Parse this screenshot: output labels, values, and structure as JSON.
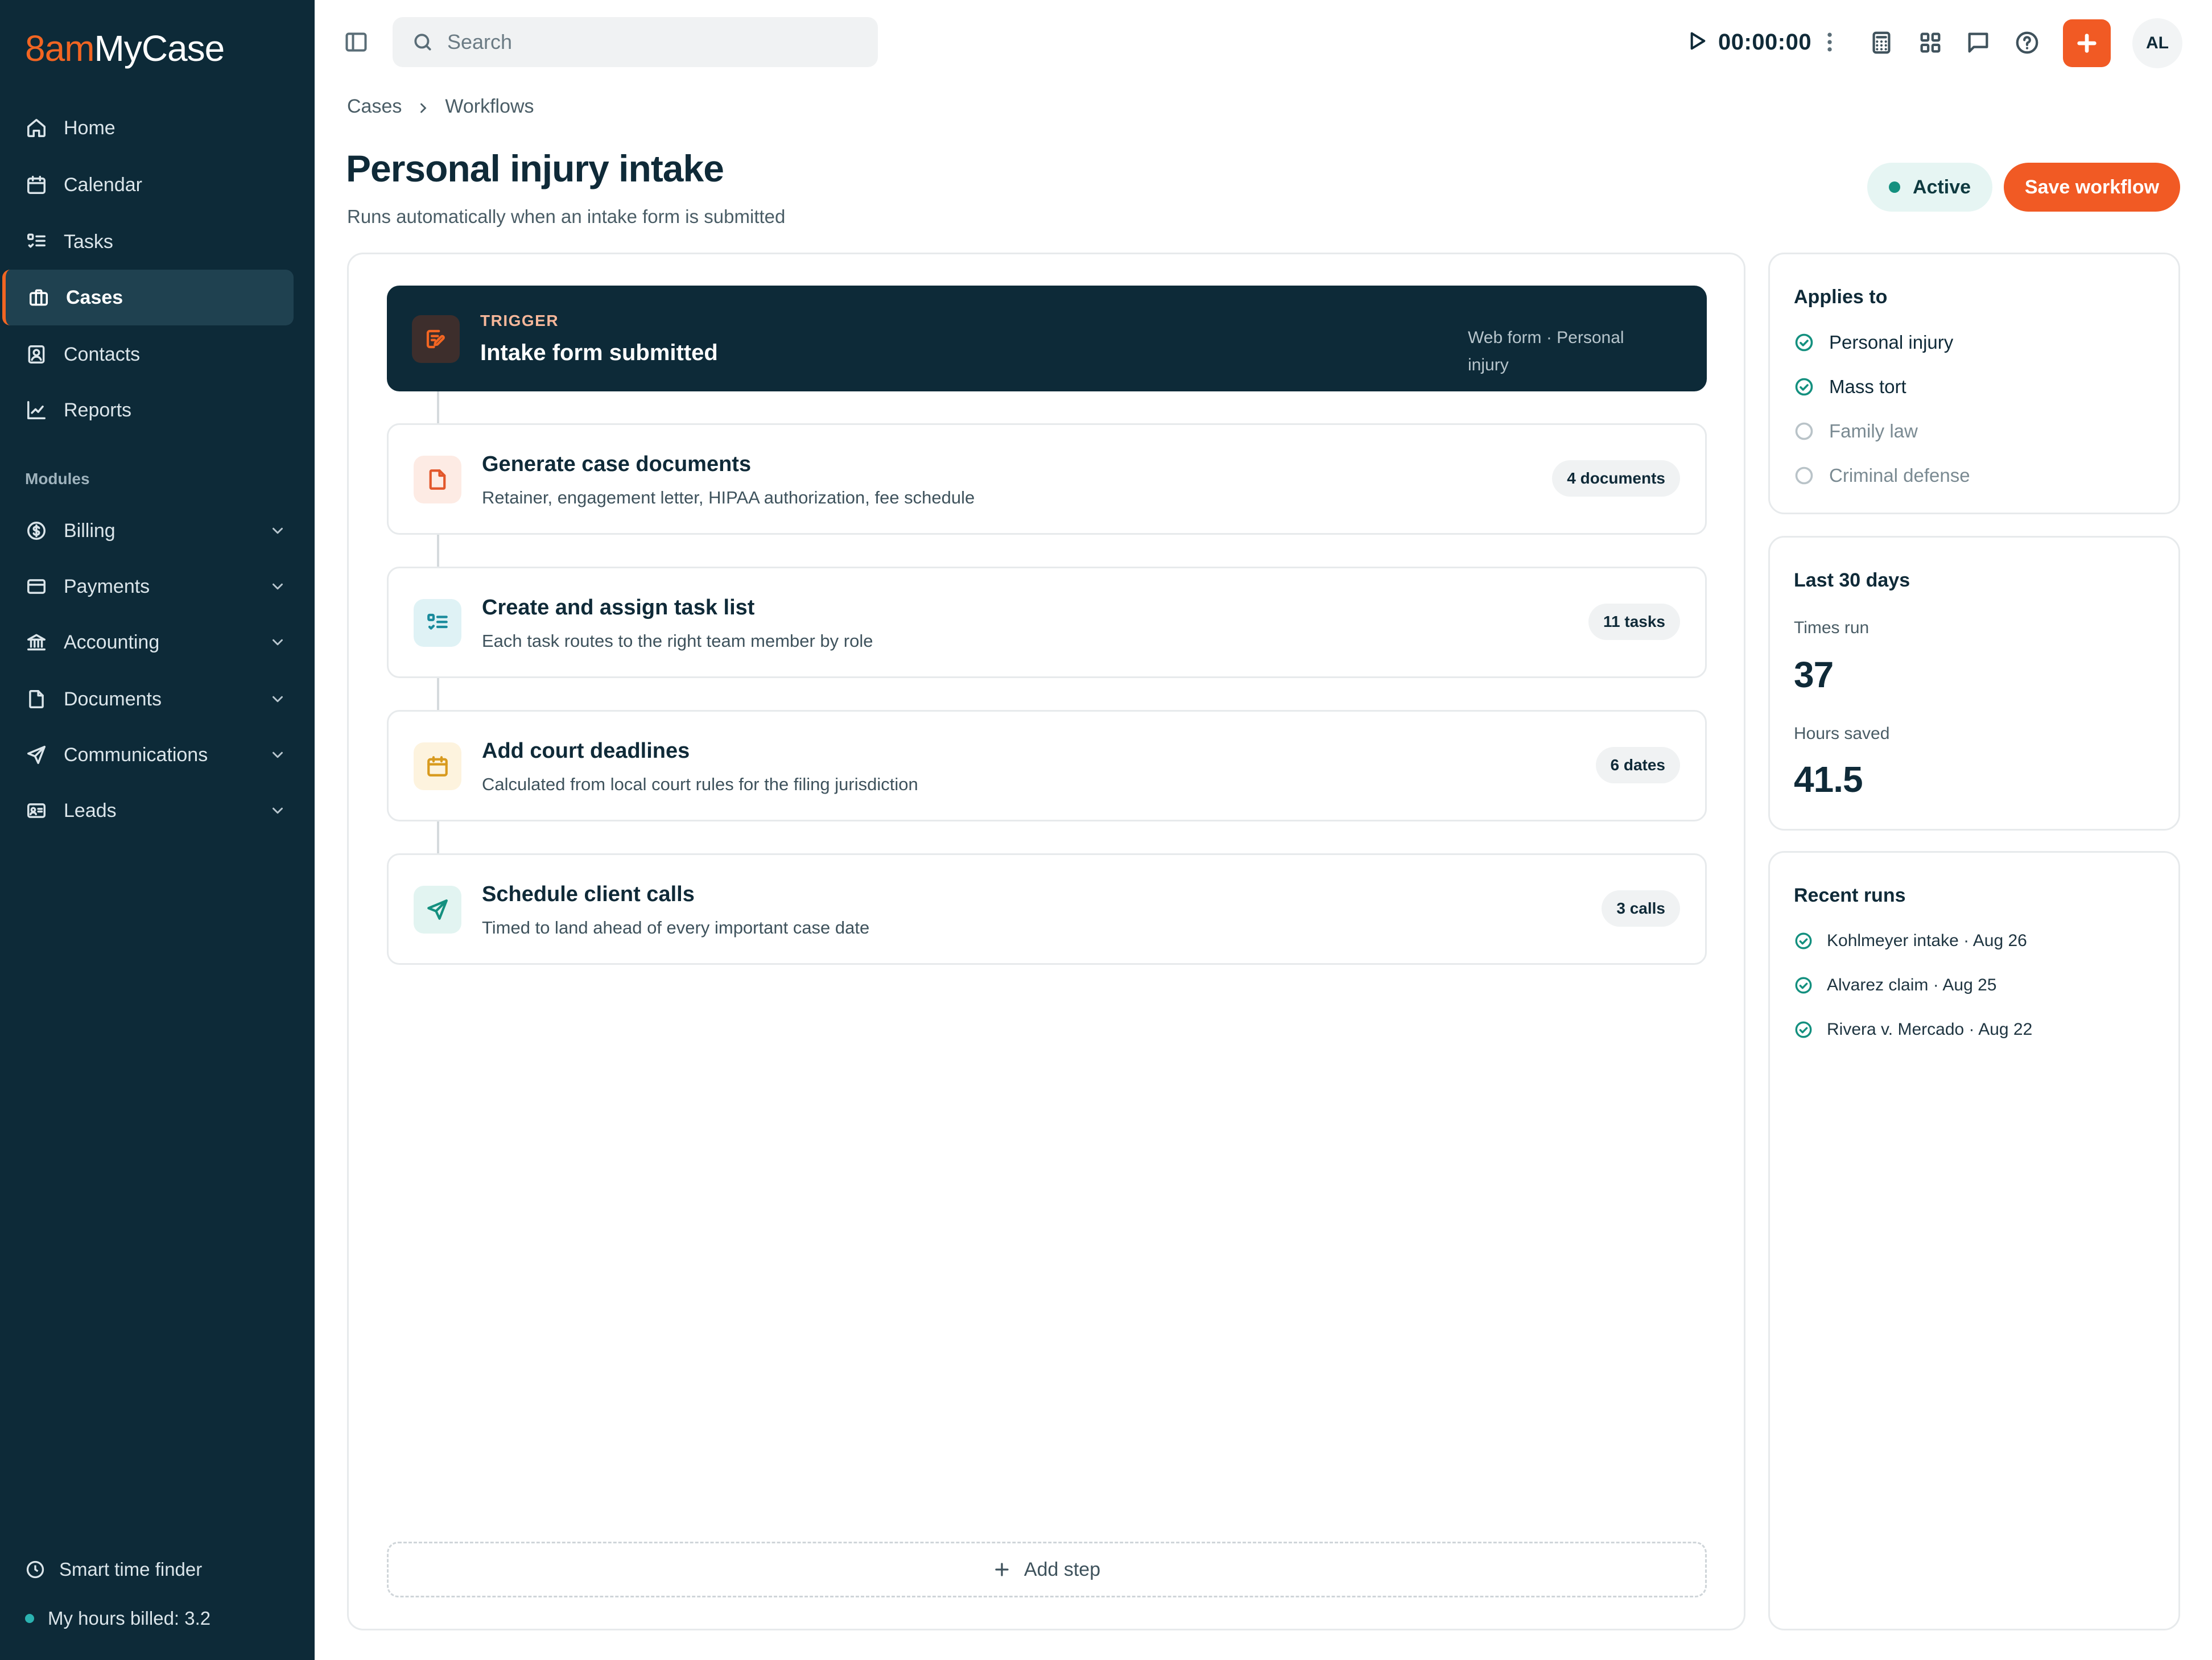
{
  "app": {
    "brand_prefix": "8am",
    "brand_name": "MyCase"
  },
  "sidebar": {
    "items": [
      {
        "label": "Home",
        "icon": "home-icon"
      },
      {
        "label": "Calendar",
        "icon": "calendar-icon"
      },
      {
        "label": "Tasks",
        "icon": "tasks-icon"
      },
      {
        "label": "Cases",
        "icon": "briefcase-icon",
        "active": true
      },
      {
        "label": "Contacts",
        "icon": "contacts-icon"
      },
      {
        "label": "Reports",
        "icon": "chart-icon"
      }
    ],
    "modules_label": "Modules",
    "modules": [
      {
        "label": "Billing",
        "icon": "dollar-icon"
      },
      {
        "label": "Payments",
        "icon": "card-icon"
      },
      {
        "label": "Accounting",
        "icon": "bank-icon"
      },
      {
        "label": "Documents",
        "icon": "document-icon"
      },
      {
        "label": "Communications",
        "icon": "send-icon"
      },
      {
        "label": "Leads",
        "icon": "id-card-icon"
      }
    ],
    "smart_time_finder": "Smart time finder",
    "hours_billed": "My hours billed: 3.2"
  },
  "topbar": {
    "search_placeholder": "Search",
    "timer": "00:00:00",
    "avatar_initials": "AL"
  },
  "breadcrumb": {
    "items": [
      "Cases",
      "Workflows"
    ]
  },
  "header": {
    "title": "Personal injury intake",
    "subtitle": "Runs automatically when an intake form is submitted",
    "status": "Active",
    "save_label": "Save workflow"
  },
  "trigger": {
    "label": "TRIGGER",
    "title": "Intake form submitted",
    "meta": "Web form · Personal injury"
  },
  "steps": [
    {
      "title": "Generate case documents",
      "desc": "Retainer, engagement letter, HIPAA authorization, fee schedule",
      "badge": "4 documents",
      "icon": "document-icon",
      "accent": "#e2572b",
      "bg": "#fdebe4"
    },
    {
      "title": "Create and assign task list",
      "desc": "Each task routes to the right team member by role",
      "badge": "11 tasks",
      "icon": "tasks-icon",
      "accent": "#1a8b9c",
      "bg": "#dff2f5"
    },
    {
      "title": "Add court deadlines",
      "desc": "Calculated from local court rules for the filing jurisdiction",
      "badge": "6 dates",
      "icon": "calendar-icon",
      "accent": "#d89a1e",
      "bg": "#fdf3de"
    },
    {
      "title": "Schedule client calls",
      "desc": "Timed to land ahead of every important case date",
      "badge": "3 calls",
      "icon": "send-icon",
      "accent": "#14907f",
      "bg": "#e2f4f1"
    }
  ],
  "add_step_label": "Add step",
  "applies_to": {
    "title": "Applies to",
    "options": [
      {
        "label": "Personal injury",
        "checked": true
      },
      {
        "label": "Mass tort",
        "checked": true
      },
      {
        "label": "Family law",
        "checked": false
      },
      {
        "label": "Criminal defense",
        "checked": false
      }
    ]
  },
  "last_30_days": {
    "title": "Last 30 days",
    "times_run_label": "Times run",
    "times_run": "37",
    "hours_saved_label": "Hours saved",
    "hours_saved": "41.5"
  },
  "recent_runs": {
    "title": "Recent runs",
    "items": [
      "Kohlmeyer intake · Aug 26",
      "Alvarez claim · Aug 25",
      "Rivera v. Mercado · Aug 22"
    ]
  },
  "colors": {
    "sidebar_bg": "#0d2a38",
    "accent_orange": "#f15a24",
    "success_teal": "#14907f"
  }
}
